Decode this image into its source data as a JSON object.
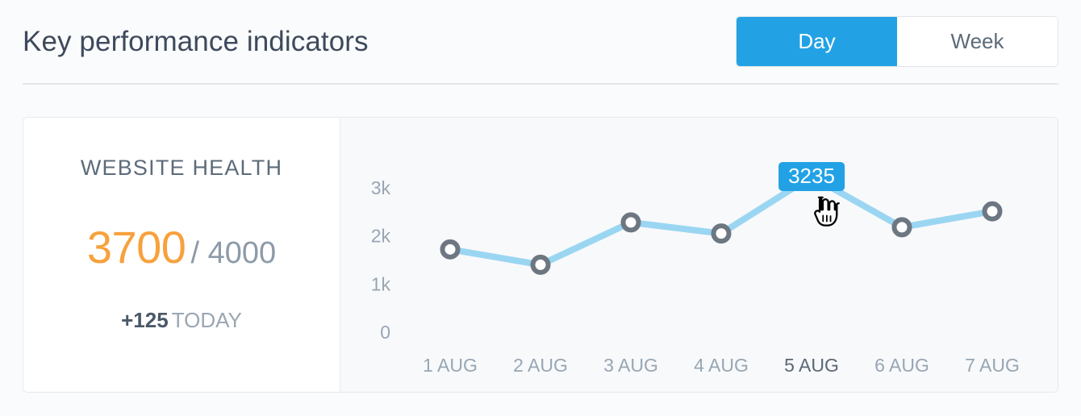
{
  "header": {
    "title": "Key performance indicators",
    "toggle": {
      "options": [
        {
          "label": "Day",
          "active": true
        },
        {
          "label": "Week",
          "active": false
        }
      ]
    }
  },
  "kpi": {
    "label": "WEBSITE HEALTH",
    "current": "3700",
    "target": "/ 4000",
    "delta_value": "+125",
    "delta_label": "TODAY"
  },
  "tooltip": {
    "value": "3235"
  },
  "colors": {
    "accent_blue": "#22a2e5",
    "line_blue": "#9ad6f2",
    "marker_gray": "#6d7782",
    "value_orange": "#f7a13d",
    "title_slate": "#3d4a5c",
    "axis_gray": "#97a6b5",
    "card_border": "#e6e9ec",
    "page_bg": "#fafbfc",
    "chart_bg": "#f8f9fb"
  },
  "icons": {
    "cursor": "pointing-hand-cursor"
  },
  "chart_data": {
    "type": "line",
    "title": "",
    "xlabel": "",
    "ylabel": "",
    "categories": [
      "1 AUG",
      "2 AUG",
      "3 AUG",
      "4 AUG",
      "5 AUG",
      "6 AUG",
      "7 AUG"
    ],
    "values": [
      1720,
      1400,
      2280,
      2050,
      3235,
      2180,
      2510
    ],
    "highlighted_category": "5 AUG",
    "highlighted_index": 4,
    "ytick_labels": [
      "3k",
      "2k",
      "1k",
      "0"
    ],
    "ytick_values": [
      3000,
      2000,
      1000,
      0
    ],
    "ylim": [
      0,
      3000
    ],
    "grid": false,
    "legend": false,
    "marker": "ring",
    "line_width": 8,
    "series": [
      {
        "name": "Website health",
        "values": [
          1720,
          1400,
          2280,
          2050,
          3235,
          2180,
          2510
        ]
      }
    ]
  }
}
